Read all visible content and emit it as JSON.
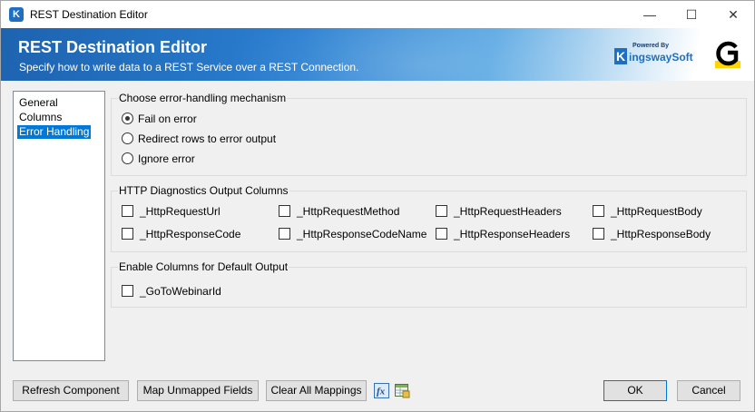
{
  "window": {
    "title": "REST Destination Editor",
    "minimize_glyph": "—",
    "maximize_glyph": "☐",
    "close_glyph": "✕",
    "app_icon_letter": "K"
  },
  "banner": {
    "title": "REST Destination Editor",
    "subtitle": "Specify how to write data to a REST Service over a REST Connection.",
    "vendor_powered_by": "Powered By",
    "vendor_name": "ingswaySoft",
    "vendor_letter": "K"
  },
  "nav": {
    "items": [
      {
        "label": "General",
        "selected": false
      },
      {
        "label": "Columns",
        "selected": false
      },
      {
        "label": "Error Handling",
        "selected": true
      }
    ]
  },
  "error_handling": {
    "group_label": "Choose error-handling mechanism",
    "options": [
      {
        "label": "Fail on error",
        "checked": true
      },
      {
        "label": "Redirect rows to error output",
        "checked": false
      },
      {
        "label": "Ignore error",
        "checked": false
      }
    ]
  },
  "diagnostics": {
    "group_label": "HTTP Diagnostics Output Columns",
    "columns": [
      {
        "label": "_HttpRequestUrl",
        "checked": false
      },
      {
        "label": "_HttpRequestMethod",
        "checked": false
      },
      {
        "label": "_HttpRequestHeaders",
        "checked": false
      },
      {
        "label": "_HttpRequestBody",
        "checked": false
      },
      {
        "label": "_HttpResponseCode",
        "checked": false
      },
      {
        "label": "_HttpResponseCodeName",
        "checked": false
      },
      {
        "label": "_HttpResponseHeaders",
        "checked": false
      },
      {
        "label": "_HttpResponseBody",
        "checked": false
      }
    ]
  },
  "default_output": {
    "group_label": "Enable Columns for Default Output",
    "columns": [
      {
        "label": "_GoToWebinarId",
        "checked": false
      }
    ]
  },
  "footer": {
    "refresh_label": "Refresh Component",
    "map_unmapped_label": "Map Unmapped Fields",
    "clear_mappings_label": "Clear All Mappings",
    "expression_icon_text": "fx",
    "ok_label": "OK",
    "cancel_label": "Cancel"
  },
  "colors": {
    "accent": "#0078d7",
    "banner_blue": "#1d63b0",
    "vendor_blue": "#1e6fc2",
    "brand_yellow": "#ffd400"
  }
}
